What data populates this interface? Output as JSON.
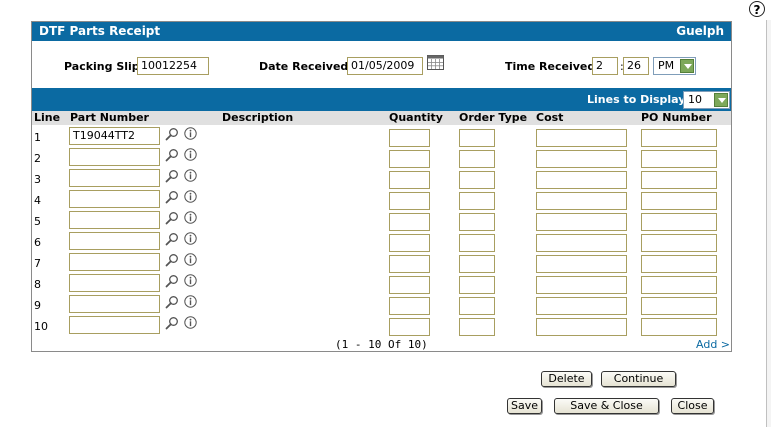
{
  "help": {
    "icon": "question-icon",
    "glyph": "?"
  },
  "header": {
    "title": "DTF Parts Receipt",
    "location": "Guelph"
  },
  "form": {
    "packing_slip_label": "Packing Slip:",
    "packing_slip_value": "10012254",
    "date_label": "Date Received:",
    "date_value": "01/05/2009",
    "time_label": "Time Received:",
    "time_hour": "2",
    "time_sep": ":",
    "time_minute": "26",
    "time_ampm": "PM"
  },
  "lines_to_display": {
    "label": "Lines to Display:",
    "value": "10"
  },
  "columns": [
    "Line",
    "Part Number",
    "Description",
    "Quantity",
    "Order Type",
    "Cost",
    "PO Number"
  ],
  "rows": [
    {
      "line": "1",
      "part": "T19044TT2"
    },
    {
      "line": "2",
      "part": ""
    },
    {
      "line": "3",
      "part": ""
    },
    {
      "line": "4",
      "part": ""
    },
    {
      "line": "5",
      "part": ""
    },
    {
      "line": "6",
      "part": ""
    },
    {
      "line": "7",
      "part": ""
    },
    {
      "line": "8",
      "part": ""
    },
    {
      "line": "9",
      "part": ""
    },
    {
      "line": "10",
      "part": ""
    }
  ],
  "pager": "(1 - 10 Of 10)",
  "add_link": "Add >",
  "buttons": {
    "delete": "Delete",
    "continue": "Continue",
    "save": "Save",
    "save_close": "Save & Close",
    "close": "Close"
  },
  "colors": {
    "header_blue": "#0b6aa2",
    "input_border": "#a89e60",
    "column_header_bg": "#e0e0e0"
  }
}
